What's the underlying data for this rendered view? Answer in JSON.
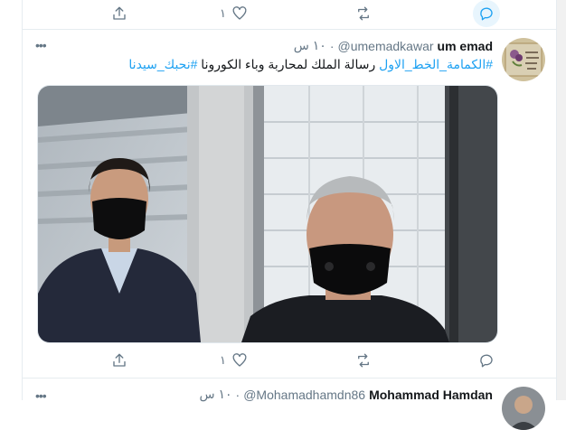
{
  "top_actions": {
    "like_count": "١"
  },
  "tweet": {
    "name": "um emad",
    "handle": "@umemadkawar",
    "time": "١٠ س",
    "text_plain": "رسالة الملك لمحاربة وباء الكورونا",
    "hashtag_1": "#الكمامة_الخط_الاول",
    "hashtag_2": "#نحبك_سيدنا",
    "like_count": "١"
  },
  "next_tweet": {
    "name": "Mohammad Hamdan",
    "handle": "@Mohamadhamdn86",
    "time": "١٠ س"
  },
  "colors": {
    "accent": "#1da1f2",
    "muted": "#657786",
    "border": "#e6ecf0"
  }
}
